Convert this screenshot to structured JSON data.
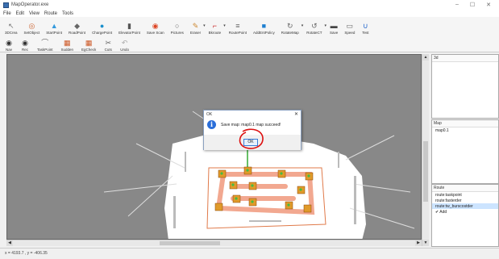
{
  "window": {
    "title": "MapOperator.exe",
    "minimize": "–",
    "maximize": "☐",
    "close": "✕"
  },
  "menu": [
    "File",
    "Edit",
    "View",
    "Route",
    "Tools"
  ],
  "toolbar_row1": [
    {
      "label": "3DCrea",
      "icon": "cursor-icon",
      "color": "#777777",
      "glyph": "↖",
      "dropdown": false
    },
    {
      "label": "SetObject",
      "icon": "target-icon",
      "color": "#cc6633",
      "glyph": "◎",
      "dropdown": false
    },
    {
      "label": "StartPoint",
      "icon": "start-flag-icon",
      "color": "#3399dd",
      "glyph": "▲",
      "dropdown": false
    },
    {
      "label": "RoadPoint",
      "icon": "road-point-icon",
      "color": "#666666",
      "glyph": "◆",
      "dropdown": false
    },
    {
      "label": "ChargePoint",
      "icon": "charge-point-icon",
      "color": "#1a8fcc",
      "glyph": "●",
      "dropdown": false
    },
    {
      "label": "ElevatorPoint",
      "icon": "elevator-icon",
      "color": "#555555",
      "glyph": "▮",
      "dropdown": false
    },
    {
      "label": "Save Scan",
      "icon": "save-scan-icon",
      "color": "#dd4422",
      "glyph": "◉",
      "dropdown": false
    },
    {
      "label": "Pictures",
      "icon": "picture-icon",
      "color": "#666666",
      "glyph": "○",
      "dropdown": false
    },
    {
      "label": "Eraser",
      "icon": "eraser-icon",
      "color": "#cc8833",
      "glyph": "✎",
      "dropdown": true
    },
    {
      "label": "Bkroute",
      "icon": "route-icon",
      "color": "#cc3333",
      "glyph": "⌐",
      "dropdown": true
    },
    {
      "label": "RoutePoint",
      "icon": "route-point-icon",
      "color": "#666666",
      "glyph": "≡",
      "dropdown": false
    },
    {
      "label": "AddEntPolicy",
      "icon": "policy-icon",
      "color": "#1e7fd0",
      "glyph": "■",
      "dropdown": false
    },
    {
      "label": "RotateMap",
      "icon": "rotate-icon",
      "color": "#666666",
      "glyph": "↻",
      "dropdown": true
    },
    {
      "label": "RotateCT",
      "icon": "rotate-ct-icon",
      "color": "#666666",
      "glyph": "↺",
      "dropdown": true
    },
    {
      "label": "Save",
      "icon": "save-icon",
      "color": "#444444",
      "glyph": "▬",
      "dropdown": false
    },
    {
      "label": "Speed",
      "icon": "speed-icon",
      "color": "#666666",
      "glyph": "▭",
      "dropdown": false
    },
    {
      "label": "Test",
      "icon": "test-icon",
      "color": "#2266cc",
      "glyph": "∪",
      "dropdown": false
    }
  ],
  "toolbar_row2": [
    {
      "label": "Nav",
      "icon": "nav-icon",
      "color": "#333333",
      "glyph": "◉"
    },
    {
      "label": "Rec",
      "icon": "record-icon",
      "color": "#333333",
      "glyph": "◉"
    },
    {
      "label": "TaskPoint",
      "icon": "task-point-icon",
      "color": "#666666",
      "glyph": "⌒"
    },
    {
      "label": "Sudden",
      "icon": "sudden-icon",
      "color": "#cc5522",
      "glyph": "▦"
    },
    {
      "label": "EgCheck",
      "icon": "check-icon",
      "color": "#cc5522",
      "glyph": "▦"
    },
    {
      "label": "Cuts",
      "icon": "cut-icon",
      "color": "#666666",
      "glyph": "✂"
    },
    {
      "label": "Undo",
      "icon": "undo-icon",
      "color": "#aaaaaa",
      "glyph": "↶"
    }
  ],
  "dialog": {
    "title": "OK",
    "message": "Save map: map0.1 map succeed!",
    "ok_label": "OK",
    "close_glyph": "✕",
    "info_glyph": "i"
  },
  "panels": {
    "three_d": {
      "title": "3d",
      "items": []
    },
    "map": {
      "title": "Map",
      "items": [
        "map0.1"
      ]
    },
    "route": {
      "title": "Route",
      "items": [
        "route:taskpoint",
        "route:fasterder",
        "route:tw_burscostder",
        "✔ Add"
      ]
    }
  },
  "status": {
    "text": "x = 4193.7 , y = -406.35"
  },
  "scroll_arrows": {
    "up": "▲",
    "down": "▼",
    "left": "◀",
    "right": "▶"
  }
}
